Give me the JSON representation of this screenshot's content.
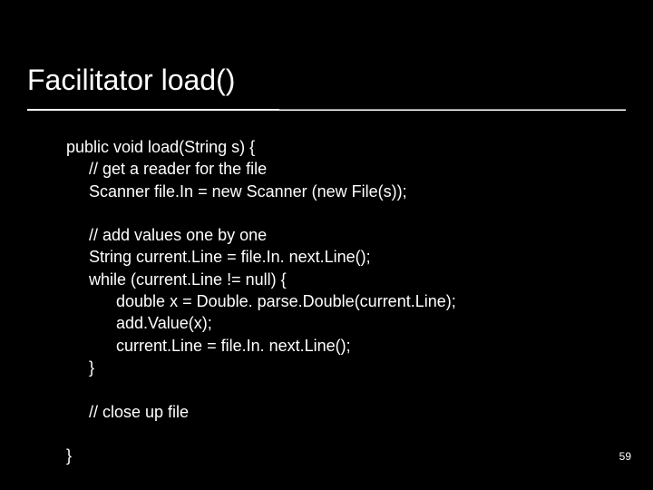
{
  "title": "Facilitator load()",
  "code": {
    "l01": "public void load(String s) {",
    "l02": "     // get a reader for the file",
    "l03": "     Scanner file.In = new Scanner (new File(s));",
    "l04": "",
    "l05": "     // add values one by one",
    "l06": "     String current.Line = file.In. next.Line();",
    "l07": "     while (current.Line != null) {",
    "l08": "           double x = Double. parse.Double(current.Line);",
    "l09": "           add.Value(x);",
    "l10": "           current.Line = file.In. next.Line();",
    "l11": "     }",
    "l12": "",
    "l13": "     // close up file",
    "l14": "",
    "l15": "}"
  },
  "page_number": "59"
}
